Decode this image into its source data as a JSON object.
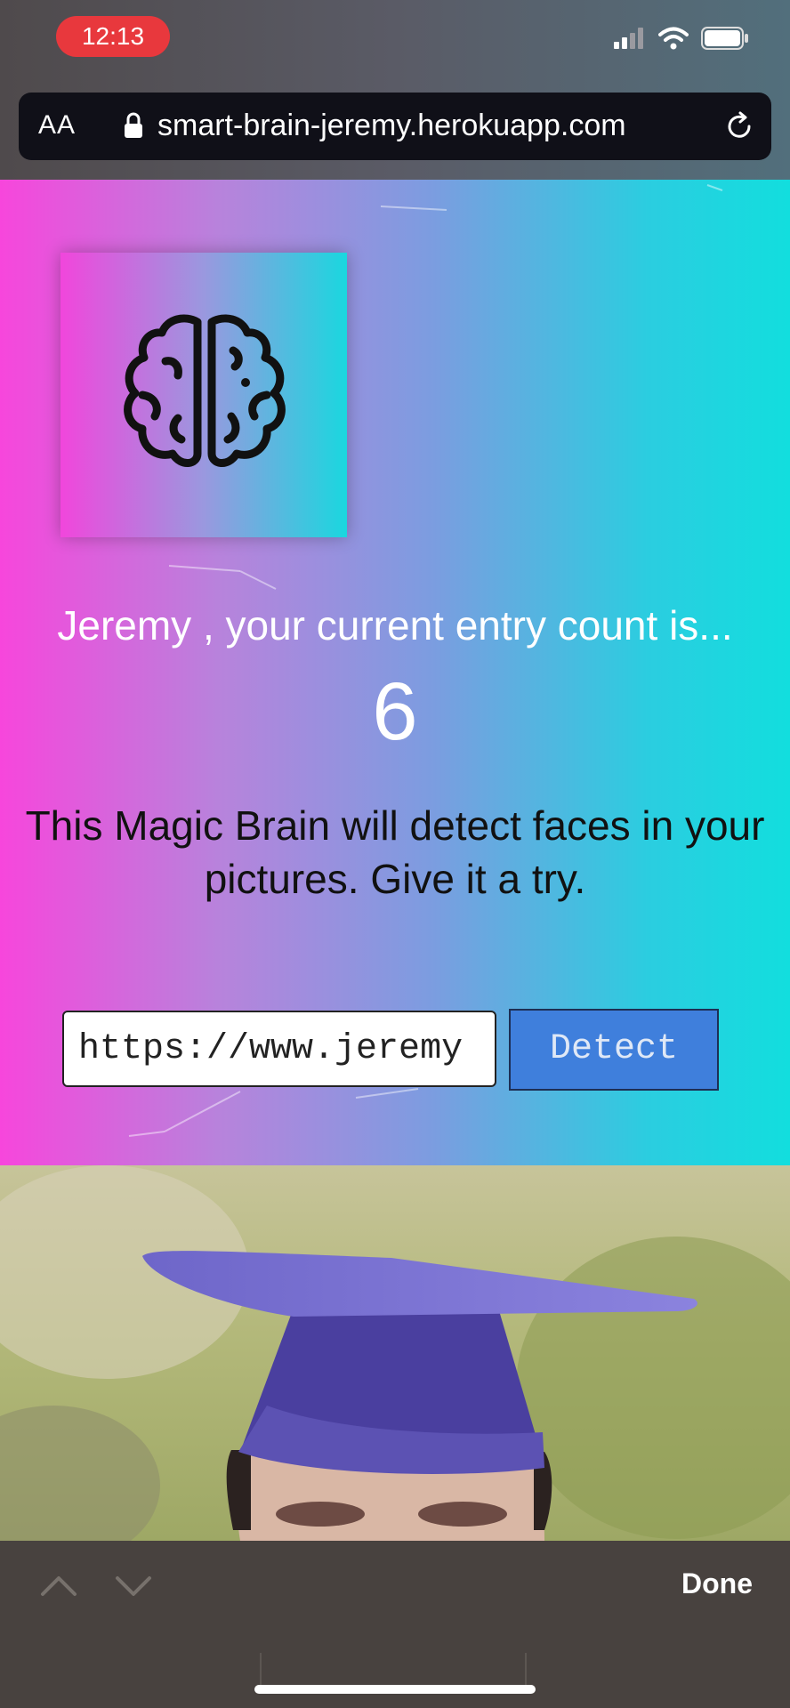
{
  "status_bar": {
    "time": "12:13",
    "icons": [
      "signal-icon",
      "wifi-icon",
      "battery-icon"
    ]
  },
  "browser": {
    "text_size_button": "AA",
    "url": "smart-brain-jeremy.herokuapp.com",
    "icons": [
      "lock-icon",
      "reload-icon"
    ]
  },
  "app": {
    "logo_icon": "brain-icon",
    "greeting": "Jeremy , your current entry count is...",
    "entry_count": "6",
    "description": "This Magic Brain will detect faces in your pictures. Give it a try.",
    "image_url_input": {
      "value": "https://www.jeremy"
    },
    "detect_button": "Detect"
  },
  "find_bar": {
    "done_label": "Done",
    "icons": [
      "chevron-up-icon",
      "chevron-down-icon"
    ]
  },
  "colors": {
    "gradient_start": "#f746dc",
    "gradient_end": "#12dede",
    "detect_button_bg": "#3f7fdc",
    "time_pill": "#e8383d"
  }
}
